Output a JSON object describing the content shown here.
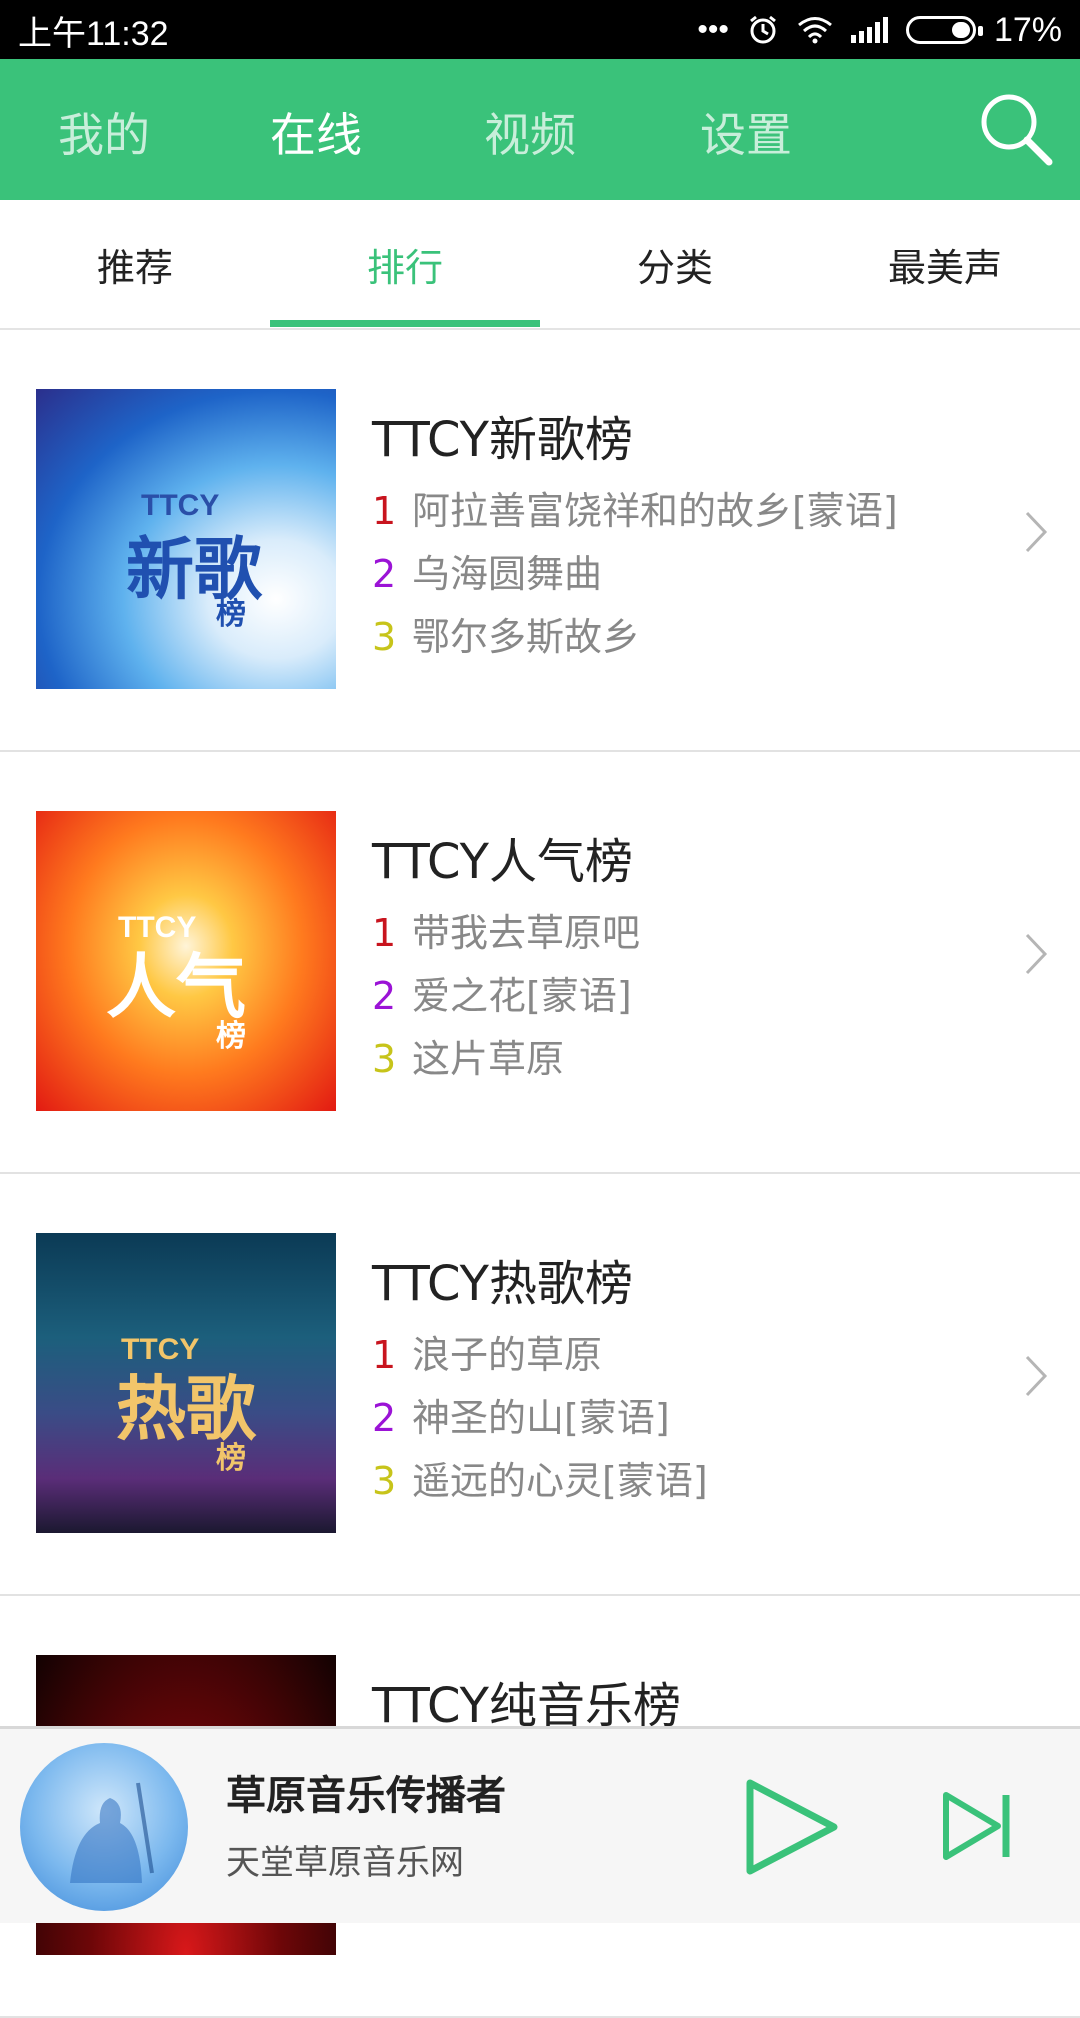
{
  "status_bar": {
    "time": "上午11:32",
    "battery": "17%"
  },
  "top_nav": {
    "tabs": [
      {
        "label": "我的",
        "active": false
      },
      {
        "label": "在线",
        "active": true
      },
      {
        "label": "视频",
        "active": false
      },
      {
        "label": "设置",
        "active": false
      }
    ]
  },
  "sub_tabs": [
    {
      "label": "推荐",
      "active": false
    },
    {
      "label": "排行",
      "active": true
    },
    {
      "label": "分类",
      "active": false
    },
    {
      "label": "最美声",
      "active": false
    }
  ],
  "colors": {
    "brand_green": "#3ac27a",
    "rank1": "#c8141e",
    "rank2": "#9b13d6",
    "rank3": "#c7c41a"
  },
  "charts": [
    {
      "title": "TTCY新歌榜",
      "cover_text": {
        "brand": "TTCY",
        "chars": "新歌",
        "small": "榜"
      },
      "tracks": [
        {
          "rank": "1",
          "name": "阿拉善富饶祥和的故乡[蒙语]"
        },
        {
          "rank": "2",
          "name": "乌海圆舞曲"
        },
        {
          "rank": "3",
          "name": "鄂尔多斯故乡"
        }
      ]
    },
    {
      "title": "TTCY人气榜",
      "cover_text": {
        "brand": "TTCY",
        "chars": "人气",
        "small": "榜"
      },
      "tracks": [
        {
          "rank": "1",
          "name": "带我去草原吧"
        },
        {
          "rank": "2",
          "name": "爱之花[蒙语]"
        },
        {
          "rank": "3",
          "name": "这片草原"
        }
      ]
    },
    {
      "title": "TTCY热歌榜",
      "cover_text": {
        "brand": "TTCY",
        "chars": "热歌",
        "small": "榜"
      },
      "tracks": [
        {
          "rank": "1",
          "name": "浪子的草原"
        },
        {
          "rank": "2",
          "name": "神圣的山[蒙语]"
        },
        {
          "rank": "3",
          "name": "遥远的心灵[蒙语]"
        }
      ]
    },
    {
      "title": "TTCY纯音乐榜"
    }
  ],
  "player": {
    "title": "草原音乐传播者",
    "subtitle": "天堂草原音乐网"
  }
}
